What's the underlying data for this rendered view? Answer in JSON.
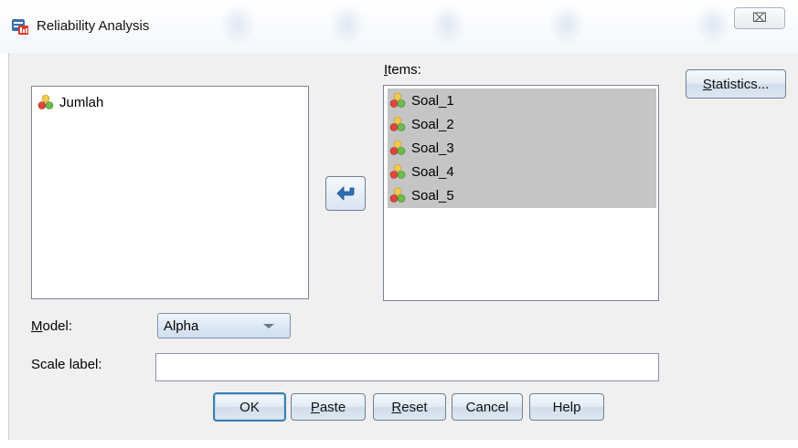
{
  "window": {
    "title": "Reliability Analysis",
    "close_glyph": "⌧"
  },
  "source_list": {
    "items": [
      {
        "label": "Jumlah",
        "icon": "scale-variable-icon"
      }
    ]
  },
  "items_list": {
    "label_prefix": "",
    "label_mnemonic": "I",
    "label_rest": "tems:",
    "items": [
      {
        "label": "Soal_1",
        "icon": "scale-variable-icon",
        "selected": true
      },
      {
        "label": "Soal_2",
        "icon": "scale-variable-icon",
        "selected": true
      },
      {
        "label": "Soal_3",
        "icon": "scale-variable-icon",
        "selected": true
      },
      {
        "label": "Soal_4",
        "icon": "scale-variable-icon",
        "selected": true
      },
      {
        "label": "Soal_5",
        "icon": "scale-variable-icon",
        "selected": true
      }
    ]
  },
  "buttons": {
    "statistics": {
      "mnemonic": "S",
      "rest": "tatistics..."
    },
    "ok": "OK",
    "paste": {
      "mnemonic": "P",
      "rest": "aste"
    },
    "reset": {
      "mnemonic": "R",
      "rest": "eset"
    },
    "cancel": "Cancel",
    "help": "Help"
  },
  "model": {
    "label_mnemonic": "M",
    "label_rest": "odel:",
    "selected": "Alpha"
  },
  "scale_label": {
    "label": "Scale label:",
    "value": ""
  },
  "colors": {
    "selection": "#c5c5c5",
    "dialog_bg": "#f0f0f0",
    "accent_blue": "#3c7fb1"
  }
}
